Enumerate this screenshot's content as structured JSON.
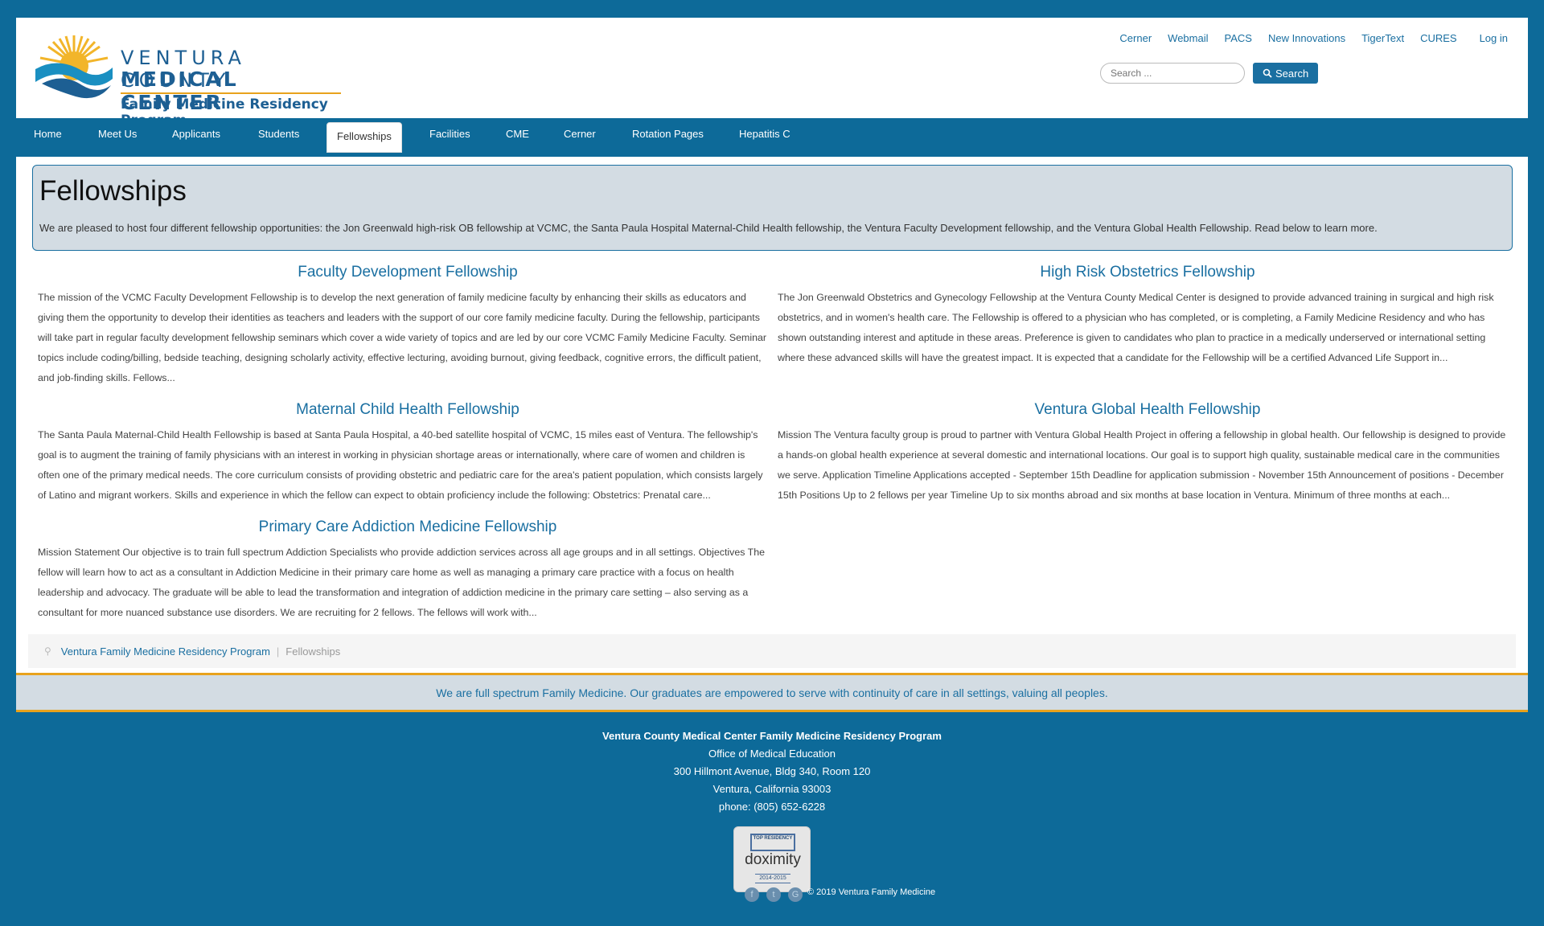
{
  "header": {
    "logo": {
      "line1": "VENTURA COUNTY",
      "line2": "MEDICAL CENTER",
      "line3": "Family Medicine Residency Program"
    },
    "top_links": [
      "Cerner",
      "Webmail",
      "PACS",
      "New Innovations",
      "TigerText",
      "CURES"
    ],
    "login_label": "Log in",
    "search": {
      "placeholder": "Search ...",
      "button_label": "Search"
    }
  },
  "nav": {
    "items": [
      "Home",
      "Meet Us",
      "Applicants",
      "Students",
      "Fellowships",
      "Facilities",
      "CME",
      "Cerner",
      "Rotation Pages",
      "Hepatitis C"
    ],
    "active": "Fellowships"
  },
  "intro": {
    "title": "Fellowships",
    "text": "We are pleased to host four different fellowship opportunities: the Jon Greenwald high-risk OB fellowship at VCMC, the Santa Paula Hospital Maternal-Child Health fellowship, the Ventura Faculty Development fellowship, and the Ventura Global Health Fellowship.  Read below to learn more."
  },
  "fellowships": [
    {
      "title": "Faculty Development Fellowship",
      "text": "The mission of the VCMC Faculty Development Fellowship is to develop the next generation of family medicine faculty by enhancing their skills as educators and giving them the opportunity to develop their identities as teachers and leaders with the support of our core family medicine faculty. During the fellowship, participants will take part in regular faculty development fellowship seminars which cover a wide variety of topics and are led by our core VCMC Family Medicine Faculty.  Seminar topics include coding/billing, bedside teaching, designing scholarly activity, effective lecturing, avoiding burnout, giving feedback, cognitive errors, the difficult patient, and job-finding skills. Fellows..."
    },
    {
      "title": "High Risk Obstetrics Fellowship",
      "text": "The Jon Greenwald Obstetrics and Gynecology Fellowship at the Ventura County Medical Center is designed to provide advanced training in surgical and high risk obstetrics, and in women's health care. The Fellowship is offered to a physician who has completed, or is completing, a Family Medicine Residency and who has shown outstanding interest and aptitude in these areas. Preference is given to candidates who plan to practice in a medically underserved or international setting where these advanced skills will have the greatest impact. It is expected that a candidate for the Fellowship will be a certified Advanced Life Support in..."
    },
    {
      "title": "Maternal Child Health Fellowship",
      "text": "The Santa Paula Maternal-Child Health Fellowship is based at Santa Paula Hospital, a 40-bed satellite hospital of VCMC, 15 miles east of Ventura. The fellowship's goal is to augment the training of family physicians with an interest in working in physician shortage areas or internationally, where care of women and children is often one of the primary medical needs. The core curriculum consists of providing obstetric and pediatric care for the area's patient population, which consists largely of Latino and migrant workers. Skills and experience in which the fellow can expect to obtain proficiency include the following: Obstetrics: Prenatal care..."
    },
    {
      "title": "Ventura Global Health Fellowship",
      "text": "Mission The Ventura faculty group is proud to partner with Ventura Global Health Project in offering a fellowship in global health. Our fellowship is designed to provide a hands-on global health experience at several domestic and international locations. Our goal is to support high quality, sustainable medical care in the communities we serve. Application Timeline Applications accepted - September 15th Deadline for application submission - November 15th Announcement of positions - December 15th Positions Up to 2 fellows per year Timeline Up to six months abroad and six months at base location in Ventura. Minimum of three months at each..."
    },
    {
      "title": "Primary Care Addiction Medicine Fellowship",
      "text": "Mission Statement Our objective is to train full spectrum Addiction Specialists who provide addiction services across all age groups and in all settings. Objectives The fellow will learn how to act as a consultant in Addiction Medicine in their primary care home as well as managing a primary care practice with a focus on health leadership and advocacy. The graduate will be able to lead the transformation and integration of addiction medicine in the primary care setting – also serving as a consultant for more nuanced substance use disorders. We are recruiting for 2 fellows. The fellows will work with..."
    }
  ],
  "breadcrumb": {
    "home": "Ventura Family Medicine Residency Program",
    "separator": "|",
    "current": "Fellowships"
  },
  "tagline": "We are full spectrum Family Medicine. Our graduates are empowered to serve with continuity of care in all settings, valuing all peoples.",
  "footer": {
    "org": "Ventura County Medical Center Family Medicine Residency Program",
    "dept": "Office of Medical Education",
    "address1": "300 Hillmont Avenue, Bldg 340, Room 120",
    "address2": "Ventura, California 93003",
    "phone": "phone: (805) 652-6228",
    "badge": {
      "tag": "TOP RESIDENCY",
      "brand": "doximity",
      "years": "2014-2015"
    },
    "social_icons": [
      "facebook-icon",
      "twitter-icon",
      "google-icon"
    ],
    "copyright": "© 2019 Ventura Family Medicine"
  },
  "colors": {
    "primary": "#0d6a99",
    "link": "#1a6fa1",
    "accent": "#e8a21c",
    "panel": "#d3dce3"
  }
}
